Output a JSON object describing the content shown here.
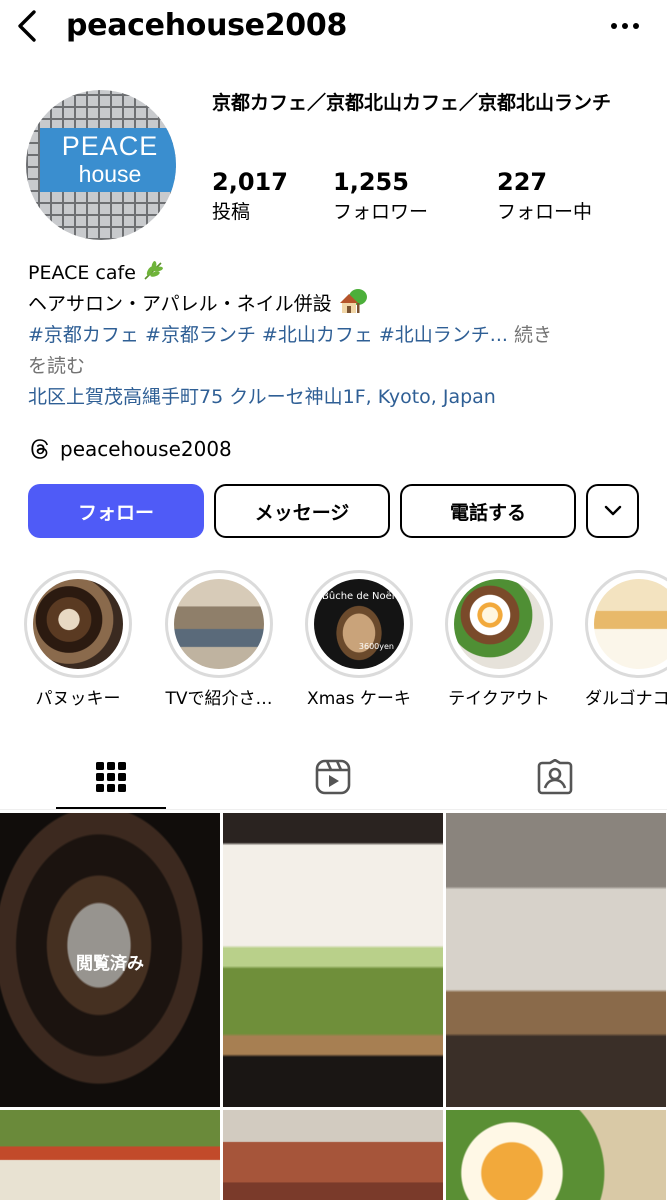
{
  "header": {
    "username": "peacehouse2008",
    "back_icon": "chevron-left-icon",
    "more_icon": "ellipsis-icon"
  },
  "profile": {
    "avatar_text_line1": "PEACE",
    "avatar_text_line2": "house",
    "name": "京都カフェ／京都北山カフェ／京都北山ランチ",
    "stats": [
      {
        "value": "2,017",
        "label": "投稿"
      },
      {
        "value": "1,255",
        "label": "フォロワー"
      },
      {
        "value": "227",
        "label": "フォロー中"
      }
    ]
  },
  "bio": {
    "line1": "PEACE cafe",
    "line2": "ヘアサロン・アパレル・ネイル併設",
    "hashtags": "#京都カフェ #京都ランチ #北山カフェ #北山ランチ...",
    "more": "続き",
    "more2": "を読む",
    "address": "北区上賀茂高縄手町75 クルーセ神山1F, Kyoto, Japan",
    "threads_handle": "peacehouse2008"
  },
  "actions": {
    "follow": "フォロー",
    "message": "メッセージ",
    "call": "電話する"
  },
  "highlights": [
    {
      "label": "パヌッキー"
    },
    {
      "label": "TVで紹介さ…"
    },
    {
      "label": "Xmas ケーキ"
    },
    {
      "label": "テイクアウト"
    },
    {
      "label": "ダルゴナコ"
    }
  ],
  "highlight_texts": {
    "buche": "Bûche de Noël",
    "price": "3600yen"
  },
  "tabs": [
    {
      "icon": "grid-icon",
      "active": true
    },
    {
      "icon": "reels-icon",
      "active": false
    },
    {
      "icon": "tagged-icon",
      "active": false
    }
  ],
  "posts": {
    "viewed_label": "閲覧済み"
  },
  "colors": {
    "follow_button": "#4f5bf7",
    "link": "#2f5f95",
    "muted": "#737373"
  }
}
